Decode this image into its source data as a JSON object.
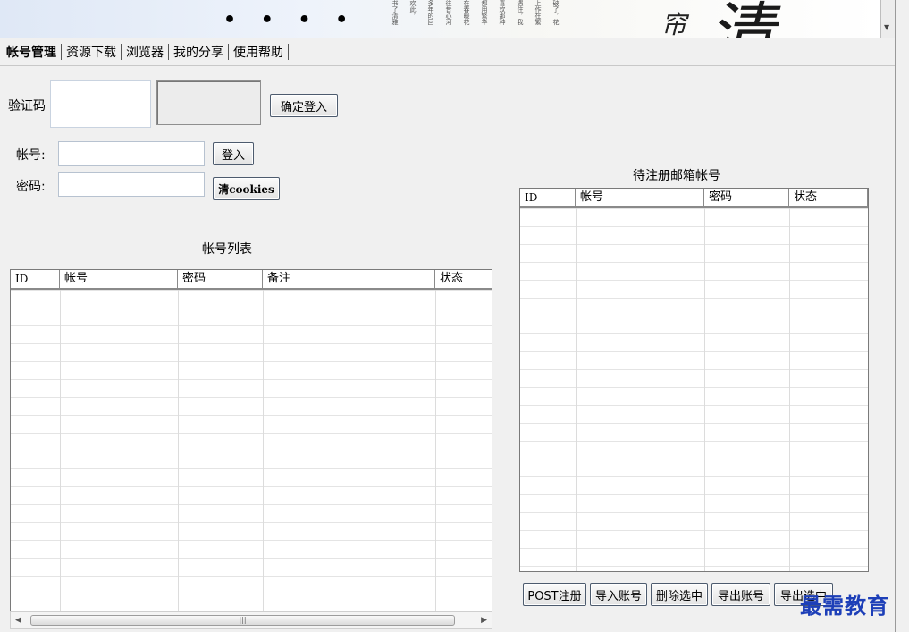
{
  "banner": {
    "dots": "• • • •",
    "poem_columns": [
      "书了清雅",
      "欢此，",
      "多年的回",
      "往昔心河",
      "在春暖花",
      "都用繁华",
      "喜欢那种",
      "遇住，我",
      "上作在繁",
      "破了，花"
    ],
    "calligraphy_small": "帘",
    "calligraphy_big": "清"
  },
  "tabs": [
    {
      "label": "帐号管理"
    },
    {
      "label": "资源下载"
    },
    {
      "label": "浏览器"
    },
    {
      "label": "我的分享"
    },
    {
      "label": "使用帮助"
    }
  ],
  "captcha": {
    "label": "验证码",
    "button": "确定登入"
  },
  "login": {
    "account_label": "帐号:",
    "password_label": "密码:",
    "login_button": "登入",
    "clear_cookies_button": "清cookies",
    "account_value": "",
    "password_value": ""
  },
  "account_list": {
    "title": "帐号列表",
    "columns": [
      "ID",
      "帐号",
      "密码",
      "备注",
      "状态"
    ]
  },
  "email_list": {
    "title": "待注册邮箱帐号",
    "columns": [
      "ID",
      "帐号",
      "密码",
      "状态"
    ]
  },
  "bottom_buttons": {
    "post_register": "POST注册",
    "import_accounts": "导入账号",
    "delete_selected": "删除选中",
    "export_accounts": "导出账号",
    "export_selected": "导出选中"
  },
  "scrollbar": {
    "grip": "|||"
  },
  "watermark": "最需教育"
}
